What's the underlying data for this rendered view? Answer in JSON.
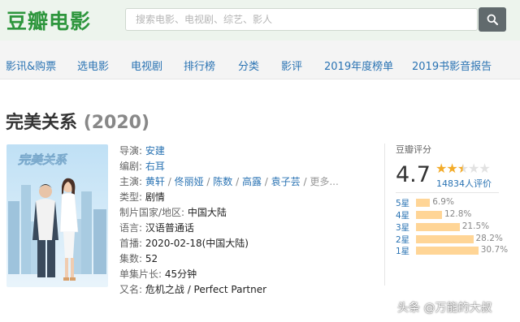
{
  "header": {
    "logo": "豆瓣电影",
    "search_placeholder": "搜索电影、电视剧、综艺、影人"
  },
  "nav": [
    {
      "label": "影讯&购票"
    },
    {
      "label": "选电影"
    },
    {
      "label": "电视剧"
    },
    {
      "label": "排行榜"
    },
    {
      "label": "分类"
    },
    {
      "label": "影评"
    },
    {
      "label": "2019年度榜单"
    },
    {
      "label": "2019书影音报告"
    }
  ],
  "movie": {
    "title": "完美关系",
    "year": "(2020)",
    "poster_title": "完美关系",
    "director_label": "导演:",
    "director": "安建",
    "writer_label": "编剧:",
    "writer": "右耳",
    "cast_label": "主演:",
    "cast": [
      "黄轩",
      "佟丽娅",
      "陈数",
      "高露",
      "袁子芸"
    ],
    "cast_sep": " / ",
    "cast_more": "更多...",
    "genre_label": "类型:",
    "genre": "剧情",
    "country_label": "制片国家/地区:",
    "country": "中国大陆",
    "language_label": "语言:",
    "language": "汉语普通话",
    "premiere_label": "首播:",
    "premiere": "2020-02-18(中国大陆)",
    "episodes_label": "集数:",
    "episodes": "52",
    "runtime_label": "单集片长:",
    "runtime": "45分钟",
    "aka_label": "又名:",
    "aka": "危机之战 / Perfect Partner"
  },
  "rating": {
    "label": "豆瓣评分",
    "score": "4.7",
    "star_value": 2.5,
    "count": "14834人评价",
    "distribution": [
      {
        "star": "5星",
        "pct": "6.9%",
        "value": 6.9
      },
      {
        "star": "4星",
        "pct": "12.8%",
        "value": 12.8
      },
      {
        "star": "3星",
        "pct": "21.5%",
        "value": 21.5
      },
      {
        "star": "2星",
        "pct": "28.2%",
        "value": 28.2
      },
      {
        "star": "1星",
        "pct": "30.7%",
        "value": 30.7
      }
    ]
  },
  "watermark": "头条 @万能的大叔",
  "colors": {
    "brand_green": "#2e963d",
    "link_blue": "#2a73b3",
    "star_gold": "#f3ab29",
    "bar_fill": "#ffd596"
  }
}
